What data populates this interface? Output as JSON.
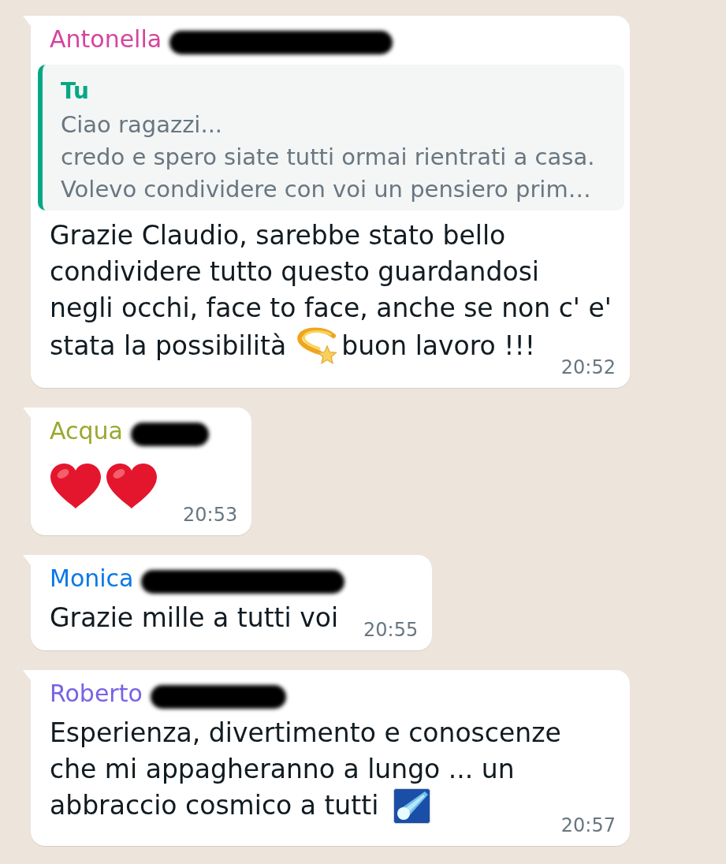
{
  "messages": [
    {
      "sender": {
        "name": "Antonella",
        "color": "#d6449e",
        "surname_redacted": true
      },
      "quote": {
        "author": "Tu",
        "lines": [
          "Ciao ragazzi...",
          "credo e spero siate tutti ormai rientrati a casa.",
          "Volevo condividere con voi un pensiero prim…"
        ]
      },
      "lines": [
        [
          {
            "kind": "text",
            "text": "Grazie Claudio, sarebbe stato bello"
          }
        ],
        [
          {
            "kind": "text",
            "text": "condividere tutto questo guardandosi"
          }
        ],
        [
          {
            "kind": "text",
            "text": "negli occhi, face to face, anche se non c' e'"
          }
        ],
        [
          {
            "kind": "text",
            "text": "stata la possibilità"
          },
          {
            "kind": "dizzy"
          },
          {
            "kind": "text",
            "text": "buon lavoro !!!"
          }
        ]
      ],
      "time": "20:52"
    },
    {
      "sender": {
        "name": "Acqua",
        "color": "#9ba832",
        "surname_redacted": true
      },
      "lines": [
        [
          {
            "kind": "heart"
          },
          {
            "kind": "heart"
          }
        ]
      ],
      "time": "20:53"
    },
    {
      "sender": {
        "name": "Monica",
        "color": "#0b78e6",
        "surname_redacted": true
      },
      "lines": [
        [
          {
            "kind": "text",
            "text": "Grazie mille a tutti voi"
          }
        ]
      ],
      "time": "20:55"
    },
    {
      "sender": {
        "name": "Roberto",
        "color": "#7a62e4",
        "surname_redacted": true
      },
      "lines": [
        [
          {
            "kind": "text",
            "text": "Esperienza, divertimento e conoscenze"
          }
        ],
        [
          {
            "kind": "text",
            "text": "che mi appagheranno a lungo ... un"
          }
        ],
        [
          {
            "kind": "text",
            "text": "abbraccio cosmico a tutti"
          },
          {
            "kind": "comet"
          }
        ]
      ],
      "time": "20:57"
    }
  ]
}
